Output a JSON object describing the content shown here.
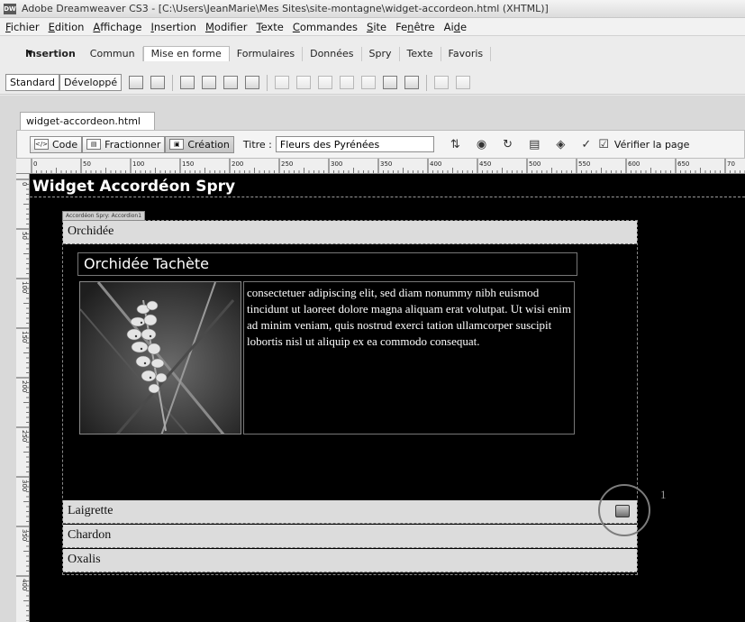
{
  "window": {
    "app_icon": "DW",
    "title": "Adobe Dreamweaver CS3 - [C:\\Users\\JeanMarie\\Mes Sites\\site-montagne\\widget-accordeon.html (XHTML)]"
  },
  "menu": [
    {
      "pre": "",
      "u": "F",
      "post": "ichier"
    },
    {
      "pre": "",
      "u": "E",
      "post": "dition"
    },
    {
      "pre": "",
      "u": "A",
      "post": "ffichage"
    },
    {
      "pre": "",
      "u": "I",
      "post": "nsertion"
    },
    {
      "pre": "",
      "u": "M",
      "post": "odifier"
    },
    {
      "pre": "",
      "u": "T",
      "post": "exte"
    },
    {
      "pre": "",
      "u": "C",
      "post": "ommandes"
    },
    {
      "pre": "",
      "u": "S",
      "post": "ite"
    },
    {
      "pre": "Fe",
      "u": "n",
      "post": "être"
    },
    {
      "pre": "Ai",
      "u": "d",
      "post": "e"
    }
  ],
  "insert_panel": {
    "label": "Insertion",
    "tabs": [
      "Commun",
      "Mise en forme",
      "Formulaires",
      "Données",
      "Spry",
      "Texte",
      "Favoris"
    ],
    "active_tab": "Mise en forme",
    "mode_buttons": [
      "Standard",
      "Développé"
    ]
  },
  "document": {
    "tab_name": "widget-accordeon.html",
    "view_buttons": [
      "Code",
      "Fractionner",
      "Création"
    ],
    "active_view": "Création",
    "title_label": "Titre :",
    "title_value": "Fleurs des Pyrénées",
    "verify_label": "Vérifier la page"
  },
  "ruler": {
    "h_labels": [
      "0",
      "50",
      "100",
      "150",
      "200",
      "250",
      "300",
      "350",
      "400",
      "450",
      "500",
      "550",
      "600",
      "650",
      "70"
    ],
    "v_labels": [
      "0",
      "50",
      "100",
      "150",
      "200",
      "250",
      "300",
      "350",
      "400"
    ]
  },
  "page": {
    "heading": "Widget Accordéon Spry",
    "spry_label": "Accordéon Spry: Accordion1",
    "accordion": {
      "panels": [
        "Orchidée",
        "Laigrette",
        "Chardon",
        "Oxalis"
      ],
      "open_panel_title": "Orchidée Tachète",
      "body_text": "consectetuer adipiscing elit, sed diam nonummy nibh euismod tincidunt ut laoreet dolore magna aliquam erat volutpat. Ut wisi enim ad minim veniam, quis nostrud exerci tation ullamcorper suscipit lobortis nisl ut aliquip ex ea commodo consequat."
    },
    "callout_number": "1"
  }
}
